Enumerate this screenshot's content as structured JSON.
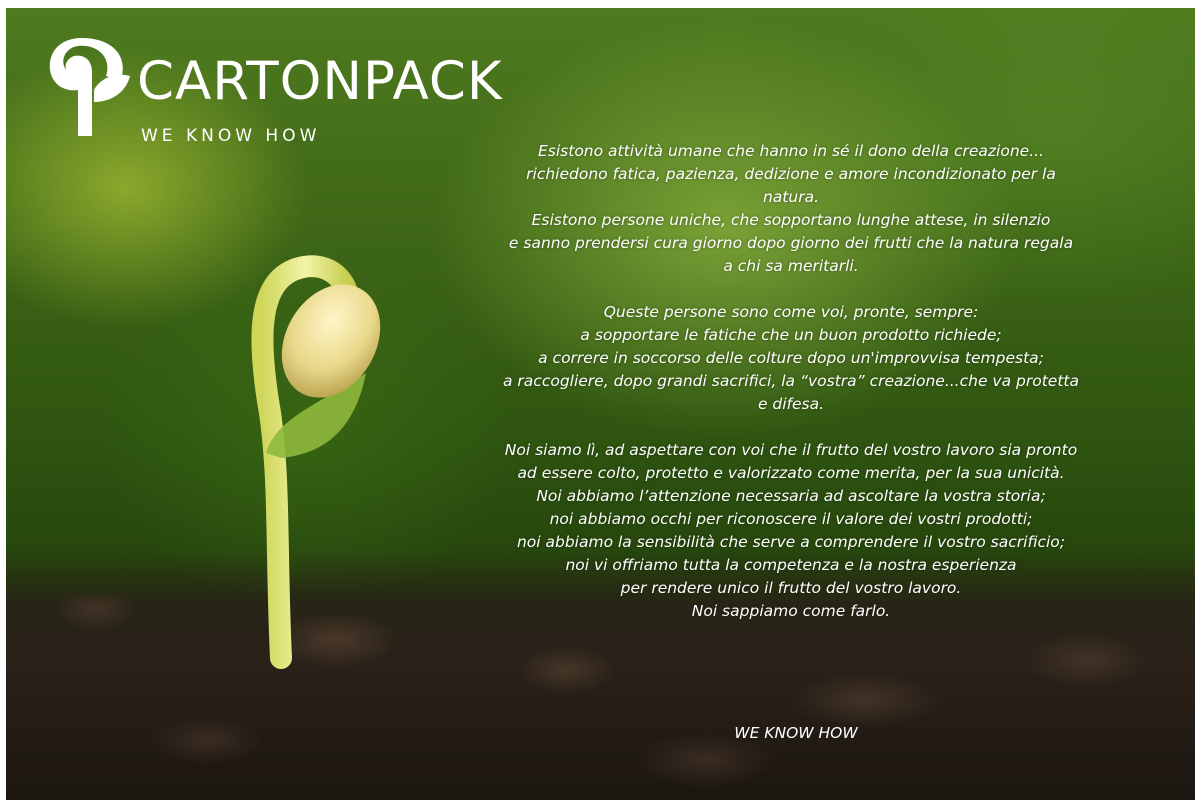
{
  "brand": {
    "name": "CARTONPACK",
    "tagline": "WE KNOW HOW",
    "logo_icon": "cartonpack-leaf-logo"
  },
  "message": {
    "paragraph1": [
      "Esistono attività umane che hanno in sé il dono della creazione...",
      "richiedono fatica, pazienza, dedizione e amore incondizionato per la",
      "natura.",
      "Esistono persone uniche, che sopportano lunghe attese, in silenzio",
      "e sanno prendersi cura giorno dopo giorno dei frutti che la natura regala",
      "a chi sa meritarli."
    ],
    "paragraph2": [
      "Queste persone sono come voi, pronte, sempre:",
      "a sopportare le fatiche che un buon prodotto richiede;",
      "a correre in soccorso delle colture dopo un'improvvisa tempesta;",
      "a raccogliere, dopo grandi sacrifici, la “vostra” creazione...che va protetta",
      "e difesa."
    ],
    "paragraph3": [
      "Noi siamo lì, ad aspettare con voi che il frutto del vostro lavoro sia pronto",
      "ad essere colto, protetto e valorizzato come merita, per la sua unicità.",
      "Noi abbiamo l’attenzione necessaria ad ascoltare la vostra storia;",
      "noi abbiamo occhi per riconoscere il valore dei vostri prodotti;",
      "noi abbiamo la sensibilità che serve a comprendere il vostro sacrificio;",
      "noi vi offriamo tutta la competenza e la nostra esperienza",
      "per rendere unico il frutto del vostro lavoro.",
      "Noi sappiamo come farlo."
    ],
    "signature": "WE KNOW HOW"
  },
  "colors": {
    "text": "#ffffff",
    "foliage": "#3d6516",
    "soil": "#2a2119",
    "sprout": "#e8ec8a"
  }
}
